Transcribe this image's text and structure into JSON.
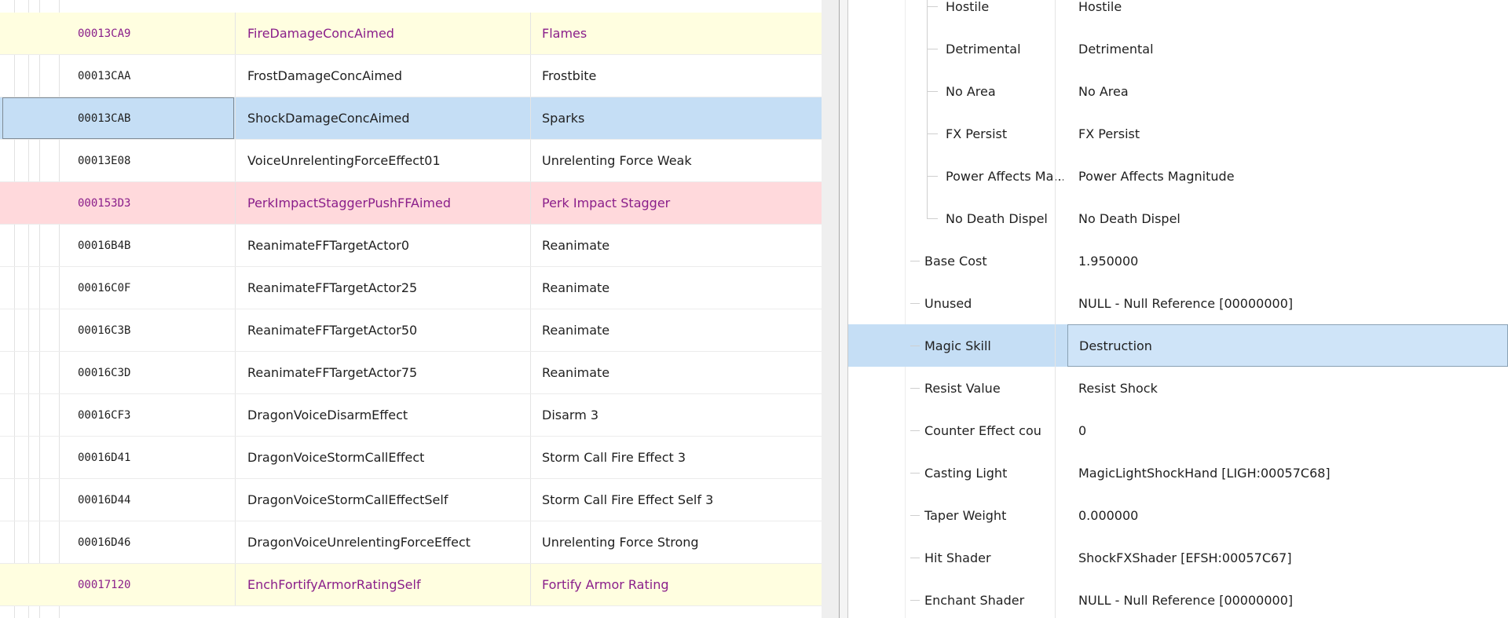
{
  "records": [
    {
      "form_id": "00013CA9",
      "editor_id": "FireDamageConcAimed",
      "name": "Flames",
      "state": "hl-yellow"
    },
    {
      "form_id": "00013CAA",
      "editor_id": "FrostDamageConcAimed",
      "name": "Frostbite",
      "state": ""
    },
    {
      "form_id": "00013CAB",
      "editor_id": "ShockDamageConcAimed",
      "name": "Sparks",
      "state": "selected"
    },
    {
      "form_id": "00013E08",
      "editor_id": "VoiceUnrelentingForceEffect01",
      "name": "Unrelenting Force Weak",
      "state": ""
    },
    {
      "form_id": "000153D3",
      "editor_id": "PerkImpactStaggerPushFFAimed",
      "name": "Perk Impact Stagger",
      "state": "hl-pink"
    },
    {
      "form_id": "00016B4B",
      "editor_id": "ReanimateFFTargetActor0",
      "name": "Reanimate",
      "state": ""
    },
    {
      "form_id": "00016C0F",
      "editor_id": "ReanimateFFTargetActor25",
      "name": "Reanimate",
      "state": ""
    },
    {
      "form_id": "00016C3B",
      "editor_id": "ReanimateFFTargetActor50",
      "name": "Reanimate",
      "state": ""
    },
    {
      "form_id": "00016C3D",
      "editor_id": "ReanimateFFTargetActor75",
      "name": "Reanimate",
      "state": ""
    },
    {
      "form_id": "00016CF3",
      "editor_id": "DragonVoiceDisarmEffect",
      "name": "Disarm 3",
      "state": ""
    },
    {
      "form_id": "00016D41",
      "editor_id": "DragonVoiceStormCallEffect",
      "name": "Storm Call Fire Effect 3",
      "state": ""
    },
    {
      "form_id": "00016D44",
      "editor_id": "DragonVoiceStormCallEffectSelf",
      "name": "Storm Call Fire Effect Self 3",
      "state": ""
    },
    {
      "form_id": "00016D46",
      "editor_id": "DragonVoiceUnrelentingForceEffect",
      "name": "Unrelenting Force Strong",
      "state": ""
    },
    {
      "form_id": "00017120",
      "editor_id": "EnchFortifyArmorRatingSelf",
      "name": "Fortify Armor Rating",
      "state": "hl-yellow"
    }
  ],
  "fields": [
    {
      "label": "Hostile",
      "value": "Hostile",
      "level": 2
    },
    {
      "label": "Detrimental",
      "value": "Detrimental",
      "level": 2
    },
    {
      "label": "No Area",
      "value": "No Area",
      "level": 2
    },
    {
      "label": "FX Persist",
      "value": "FX Persist",
      "level": 2
    },
    {
      "label": "Power Affects Ma...",
      "value": "Power Affects Magnitude",
      "level": 2
    },
    {
      "label": "No Death Dispel",
      "value": "No Death Dispel",
      "level": 2
    },
    {
      "label": "Base Cost",
      "value": "1.950000",
      "level": 1
    },
    {
      "label": "Unused",
      "value": "NULL - Null Reference [00000000]",
      "level": 1
    },
    {
      "label": "Magic Skill",
      "value": "Destruction",
      "level": 1,
      "selected": true
    },
    {
      "label": "Resist Value",
      "value": "Resist Shock",
      "level": 1
    },
    {
      "label": "Counter Effect count",
      "value": "0",
      "level": 1
    },
    {
      "label": "Casting Light",
      "value": "MagicLightShockHand [LIGH:00057C68]",
      "level": 1
    },
    {
      "label": "Taper Weight",
      "value": "0.000000",
      "level": 1
    },
    {
      "label": "Hit Shader",
      "value": "ShockFXShader [EFSH:00057C67]",
      "level": 1
    },
    {
      "label": "Enchant Shader",
      "value": "NULL - Null Reference [00000000]",
      "level": 1
    }
  ],
  "colors": {
    "highlight_yellow": "#fffee0",
    "highlight_pink": "#ffd9dc",
    "selection_blue": "#c5def5",
    "flagged_text": "#8a1e8a"
  }
}
